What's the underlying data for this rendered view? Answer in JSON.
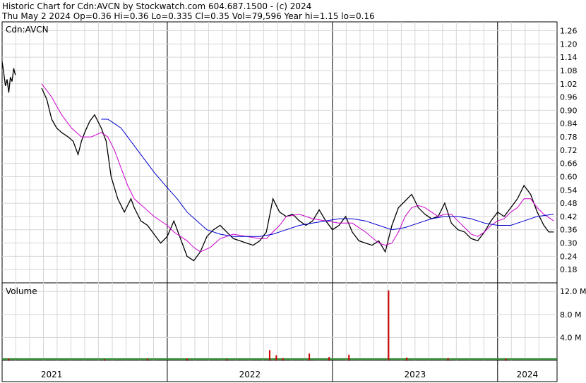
{
  "header": {
    "line1": "Historic Chart for Cdn:AVCN by Stockwatch.com 604.687.1500 - (c) 2024",
    "line2": "Thu May  2 2024  Op=0.36  Hi=0.36  Lo=0.335  Cl=0.35  Vol=79,596  Year hi=1.15  lo=0.16"
  },
  "chart_data": {
    "type": "line",
    "price_panel": {
      "label": "Cdn:AVCN",
      "ylim": [
        0.12,
        1.3
      ],
      "y_ticks": [
        1.26,
        1.2,
        1.14,
        1.08,
        1.02,
        0.96,
        0.9,
        0.84,
        0.78,
        0.72,
        0.66,
        0.6,
        0.54,
        0.48,
        0.42,
        0.36,
        0.3,
        0.24,
        0.18
      ],
      "y_tick_labels": [
        "1.26",
        "1.20",
        "1.14",
        "1.08",
        "1.02",
        "0.96",
        "0.90",
        "0.84",
        "0.78",
        "0.72",
        "0.66",
        "0.60",
        "0.54",
        "0.48",
        "0.42",
        "0.36",
        "0.30",
        "0.24",
        "0.18"
      ],
      "series": [
        {
          "color": "#000000",
          "x": [
            2021.0,
            2021.01,
            2021.02,
            2021.03,
            2021.04,
            2021.05,
            2021.06,
            2021.07,
            2021.08,
            2021.24,
            2021.27,
            2021.3,
            2021.33,
            2021.36,
            2021.4,
            2021.43,
            2021.46,
            2021.48,
            2021.5,
            2021.53,
            2021.56,
            2021.6,
            2021.63,
            2021.66,
            2021.7,
            2021.74,
            2021.78,
            2021.8,
            2021.84,
            2021.88,
            2021.92,
            2021.96,
            2022.0,
            2022.04,
            2022.08,
            2022.12,
            2022.16,
            2022.2,
            2022.24,
            2022.28,
            2022.32,
            2022.36,
            2022.4,
            2022.44,
            2022.48,
            2022.52,
            2022.56,
            2022.6,
            2022.64,
            2022.68,
            2022.72,
            2022.76,
            2022.8,
            2022.84,
            2022.88,
            2022.92,
            2022.96,
            2023.0,
            2023.04,
            2023.08,
            2023.12,
            2023.16,
            2023.2,
            2023.24,
            2023.28,
            2023.32,
            2023.36,
            2023.4,
            2023.44,
            2023.48,
            2023.52,
            2023.56,
            2023.6,
            2023.64,
            2023.68,
            2023.72,
            2023.76,
            2023.8,
            2023.84,
            2023.88,
            2023.92,
            2023.96,
            2024.0,
            2024.04,
            2024.08,
            2024.12,
            2024.16,
            2024.2,
            2024.24,
            2024.28,
            2024.31,
            2024.34
          ],
          "y": [
            1.12,
            1.07,
            1.01,
            1.04,
            0.98,
            1.05,
            1.03,
            1.09,
            1.06,
            1.0,
            0.95,
            0.86,
            0.82,
            0.8,
            0.78,
            0.76,
            0.7,
            0.76,
            0.8,
            0.85,
            0.88,
            0.82,
            0.76,
            0.6,
            0.5,
            0.44,
            0.5,
            0.46,
            0.4,
            0.38,
            0.34,
            0.3,
            0.33,
            0.4,
            0.32,
            0.24,
            0.22,
            0.26,
            0.33,
            0.36,
            0.38,
            0.35,
            0.32,
            0.31,
            0.3,
            0.29,
            0.31,
            0.35,
            0.5,
            0.44,
            0.42,
            0.43,
            0.4,
            0.38,
            0.4,
            0.45,
            0.4,
            0.36,
            0.38,
            0.42,
            0.35,
            0.31,
            0.3,
            0.29,
            0.31,
            0.26,
            0.38,
            0.46,
            0.49,
            0.52,
            0.46,
            0.43,
            0.41,
            0.42,
            0.48,
            0.39,
            0.36,
            0.35,
            0.32,
            0.31,
            0.35,
            0.4,
            0.44,
            0.42,
            0.46,
            0.5,
            0.56,
            0.52,
            0.44,
            0.38,
            0.35,
            0.35
          ]
        },
        {
          "color": "#cc00cc",
          "x": [
            2021.24,
            2021.3,
            2021.36,
            2021.42,
            2021.48,
            2021.54,
            2021.6,
            2021.64,
            2021.68,
            2021.72,
            2021.76,
            2021.8,
            2021.86,
            2021.92,
            2022.0,
            2022.04,
            2022.08,
            2022.12,
            2022.16,
            2022.2,
            2022.26,
            2022.32,
            2022.4,
            2022.48,
            2022.56,
            2022.6,
            2022.64,
            2022.68,
            2022.72,
            2022.8,
            2022.88,
            2022.96,
            2023.04,
            2023.12,
            2023.2,
            2023.28,
            2023.32,
            2023.36,
            2023.4,
            2023.44,
            2023.48,
            2023.52,
            2023.56,
            2023.6,
            2023.64,
            2023.68,
            2023.72,
            2023.76,
            2023.8,
            2023.84,
            2023.88,
            2023.92,
            2023.96,
            2024.0,
            2024.04,
            2024.08,
            2024.12,
            2024.16,
            2024.2,
            2024.24,
            2024.28,
            2024.34
          ],
          "y": [
            1.02,
            0.96,
            0.88,
            0.82,
            0.78,
            0.78,
            0.8,
            0.78,
            0.72,
            0.64,
            0.56,
            0.5,
            0.46,
            0.42,
            0.38,
            0.35,
            0.33,
            0.31,
            0.28,
            0.26,
            0.28,
            0.32,
            0.34,
            0.33,
            0.32,
            0.32,
            0.35,
            0.38,
            0.42,
            0.43,
            0.41,
            0.4,
            0.39,
            0.39,
            0.35,
            0.3,
            0.29,
            0.3,
            0.35,
            0.42,
            0.46,
            0.47,
            0.46,
            0.44,
            0.42,
            0.43,
            0.43,
            0.4,
            0.37,
            0.34,
            0.33,
            0.35,
            0.38,
            0.4,
            0.41,
            0.44,
            0.46,
            0.5,
            0.5,
            0.46,
            0.43,
            0.4
          ]
        },
        {
          "color": "#0000cc",
          "x": [
            2021.6,
            2021.64,
            2021.68,
            2021.72,
            2021.76,
            2021.8,
            2021.86,
            2021.92,
            2022.0,
            2022.06,
            2022.12,
            2022.18,
            2022.24,
            2022.32,
            2022.4,
            2022.48,
            2022.56,
            2022.64,
            2022.72,
            2022.8,
            2022.88,
            2022.96,
            2023.04,
            2023.12,
            2023.2,
            2023.28,
            2023.36,
            2023.44,
            2023.52,
            2023.6,
            2023.68,
            2023.76,
            2023.84,
            2023.92,
            2024.0,
            2024.08,
            2024.16,
            2024.24,
            2024.34
          ],
          "y": [
            0.86,
            0.86,
            0.84,
            0.82,
            0.78,
            0.74,
            0.68,
            0.62,
            0.55,
            0.5,
            0.44,
            0.4,
            0.36,
            0.34,
            0.33,
            0.33,
            0.33,
            0.34,
            0.36,
            0.38,
            0.39,
            0.4,
            0.41,
            0.41,
            0.4,
            0.38,
            0.36,
            0.37,
            0.39,
            0.41,
            0.42,
            0.42,
            0.41,
            0.39,
            0.38,
            0.38,
            0.4,
            0.42,
            0.43
          ]
        }
      ]
    },
    "volume_panel": {
      "label": "Volume",
      "ylim": [
        0,
        13.5
      ],
      "y_ticks": [
        12.0,
        8.0,
        4.0
      ],
      "y_tick_labels": [
        "12.0 M",
        "8.0 M",
        "4.0 M"
      ],
      "series": [
        {
          "color": "#cc0000",
          "x": [
            2021.04,
            2021.62,
            2021.88,
            2022.12,
            2022.36,
            2022.62,
            2022.66,
            2022.7,
            2022.86,
            2022.98,
            2023.1,
            2023.34,
            2023.45,
            2023.7,
            2024.05
          ],
          "y": [
            0.3,
            0.2,
            0.3,
            0.3,
            0.2,
            1.8,
            0.9,
            0.4,
            1.2,
            0.6,
            1.0,
            12.2,
            0.5,
            0.4,
            0.3
          ]
        }
      ]
    },
    "x_axis": {
      "xlim": [
        2021.0,
        2024.36
      ],
      "year_boundaries": [
        2021.0,
        2022.0,
        2023.0,
        2024.0
      ],
      "year_labels": [
        {
          "label": "2021",
          "x": 2021.3
        },
        {
          "label": "2022",
          "x": 2022.5
        },
        {
          "label": "2023",
          "x": 2023.5
        },
        {
          "label": "2024",
          "x": 2024.18
        }
      ],
      "month_ticks": [
        2021.083,
        2021.167,
        2021.25,
        2021.333,
        2021.417,
        2021.5,
        2021.583,
        2021.667,
        2021.75,
        2021.833,
        2021.917,
        2022.083,
        2022.167,
        2022.25,
        2022.333,
        2022.417,
        2022.5,
        2022.583,
        2022.667,
        2022.75,
        2022.833,
        2022.917,
        2023.083,
        2023.167,
        2023.25,
        2023.333,
        2023.417,
        2023.5,
        2023.583,
        2023.667,
        2023.75,
        2023.833,
        2023.917,
        2024.083,
        2024.167,
        2024.25
      ]
    },
    "grid": true
  }
}
